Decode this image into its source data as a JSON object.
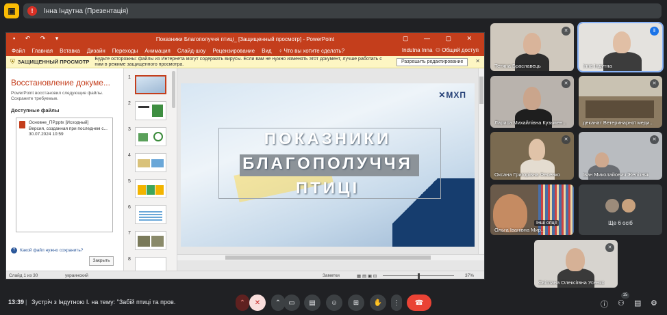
{
  "presenter": {
    "initial": "!",
    "name": "Інна Індутна (Презентація)"
  },
  "ppt": {
    "window_title": "Показники Благополуччя птиці_ [Защищенный просмотр] - PowerPoint",
    "ribbon_tabs": [
      "Файл",
      "Главная",
      "Вставка",
      "Дизайн",
      "Переходы",
      "Анимация",
      "Слайд-шоу",
      "Рецензирование",
      "Вид"
    ],
    "tell_me": "Что вы хотите сделать?",
    "user": "Indutna Inna",
    "share": "Общий доступ",
    "protected_view": {
      "label": "ЗАЩИЩЕННЫЙ ПРОСМОТР",
      "message": "Будьте осторожны: файлы из Интернета могут содержать вирусы. Если вам не нужно изменять этот документ, лучше работать с ним в режиме защищенного просмотра.",
      "enable_button": "Разрешить редактирование"
    },
    "recovery": {
      "title": "Восстановление докуме...",
      "message": "PowerPoint восстановил следующие файлы. Сохраните требуемые.",
      "available": "Доступные файлы",
      "file_name": "Основне_ПР.pptx  [Исходный]",
      "file_desc": "Версия, созданная при последнем с...",
      "file_date": "30.07.2024 10:59",
      "which_link": "Какой файл нужно сохранить?",
      "close_button": "Закрыть"
    },
    "thumbnails": [
      "1",
      "2",
      "3",
      "4",
      "5",
      "6",
      "7",
      "8"
    ],
    "slide": {
      "logo": "✕МХП",
      "title_line1": "ПОКАЗНИКИ",
      "title_line2": "БЛАГОПОЛУЧЧЯ",
      "title_line3": "ПТИЦІ"
    },
    "status": {
      "slide_info": "Слайд 1 из 30",
      "language": "украинский",
      "notes": "Заметки",
      "zoom": "37%"
    }
  },
  "participants": [
    {
      "name": "Тетяна Браславець",
      "muted": true
    },
    {
      "name": "Інна Індутна",
      "speaking": true
    },
    {
      "name": "Лариса Михайлівна Кузьмен...",
      "muted": true
    },
    {
      "name": "деканат Ветеринарної меди...",
      "muted": true
    },
    {
      "name": "Оксана Григорівна Фесенко",
      "muted": true
    },
    {
      "name": "Іван Миколайович Желізняк",
      "muted": true
    },
    {
      "name": "Ольга Іванівна Мир..."
    },
    {
      "name": "Ще 6 осіб"
    },
    {
      "name": "Світлана Олексіївна Усенко",
      "muted": true
    }
  ],
  "shared_label": "Інші опції",
  "bottom": {
    "time": "13:39",
    "meeting_title": "Зустріч з Індутною І. на тему: \"Забій птиці та пров...",
    "participants_count": "15"
  }
}
